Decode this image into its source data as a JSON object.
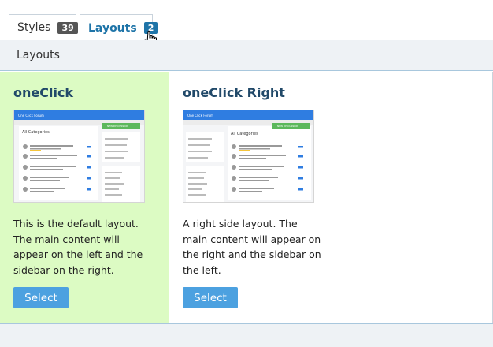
{
  "tabs": [
    {
      "label": "Styles",
      "count": "39"
    },
    {
      "label": "Layouts",
      "count": "2"
    }
  ],
  "section": {
    "title": "Layouts"
  },
  "layouts": [
    {
      "name": "oneClick",
      "description": "This is the default layout. The main content will appear on the left and the sidebar on the right.",
      "button": "Select",
      "thumbnail": {
        "forum_title": "One Click Forum",
        "heading": "All Categories",
        "new_button": "NEW DISCUSSION"
      }
    },
    {
      "name": "oneClick Right",
      "description": "A right side layout. The main content will appear on the right and the sidebar on the left.",
      "button": "Select",
      "thumbnail": {
        "forum_title": "One Click Forum",
        "heading": "All Categories",
        "new_button": "NEW DISCUSSION"
      }
    }
  ],
  "colors": {
    "accent": "#1e74a8",
    "selected_bg": "#dcfbc3",
    "button": "#4ca1e0",
    "thumb_header": "#2f7de1"
  }
}
